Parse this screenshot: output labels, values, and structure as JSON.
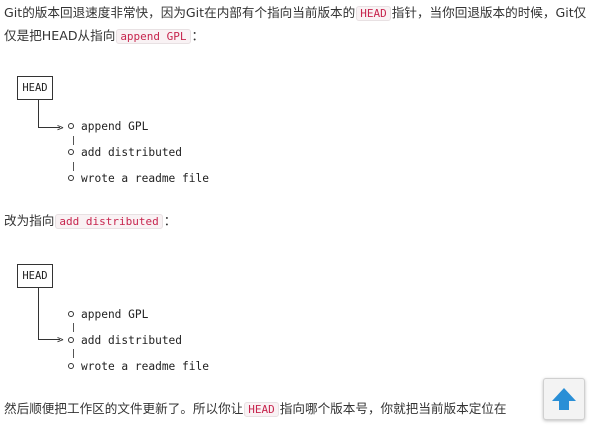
{
  "intro": {
    "part1": "Git的版本回退速度非常快，因为Git在内部有个指向当前版本的",
    "code1": "HEAD",
    "part2": "指针，当你回退版本的时候，Git仅仅是把HEAD从指向",
    "code2": "append GPL",
    "part3": "："
  },
  "diagram1": {
    "head_label": "HEAD",
    "commits": [
      {
        "message": "append GPL"
      },
      {
        "message": "add distributed"
      },
      {
        "message": "wrote a readme file"
      }
    ],
    "head_points_to_index": 0
  },
  "middle": {
    "part1": "改为指向",
    "code1": "add distributed",
    "part2": "："
  },
  "diagram2": {
    "head_label": "HEAD",
    "commits": [
      {
        "message": "append GPL"
      },
      {
        "message": "add distributed"
      },
      {
        "message": "wrote a readme file"
      }
    ],
    "head_points_to_index": 1
  },
  "outro": {
    "part1": "然后顺便把工作区的文件更新了。所以你让",
    "code1": "HEAD",
    "part2": "指向哪个版本号，你就把当前版本定位在"
  },
  "colors": {
    "code_text": "#c7254e",
    "code_bg": "#f9f2f4",
    "arrow_button": "#2a8fd6"
  },
  "icons": {
    "scroll_top": "arrow-up-icon"
  }
}
